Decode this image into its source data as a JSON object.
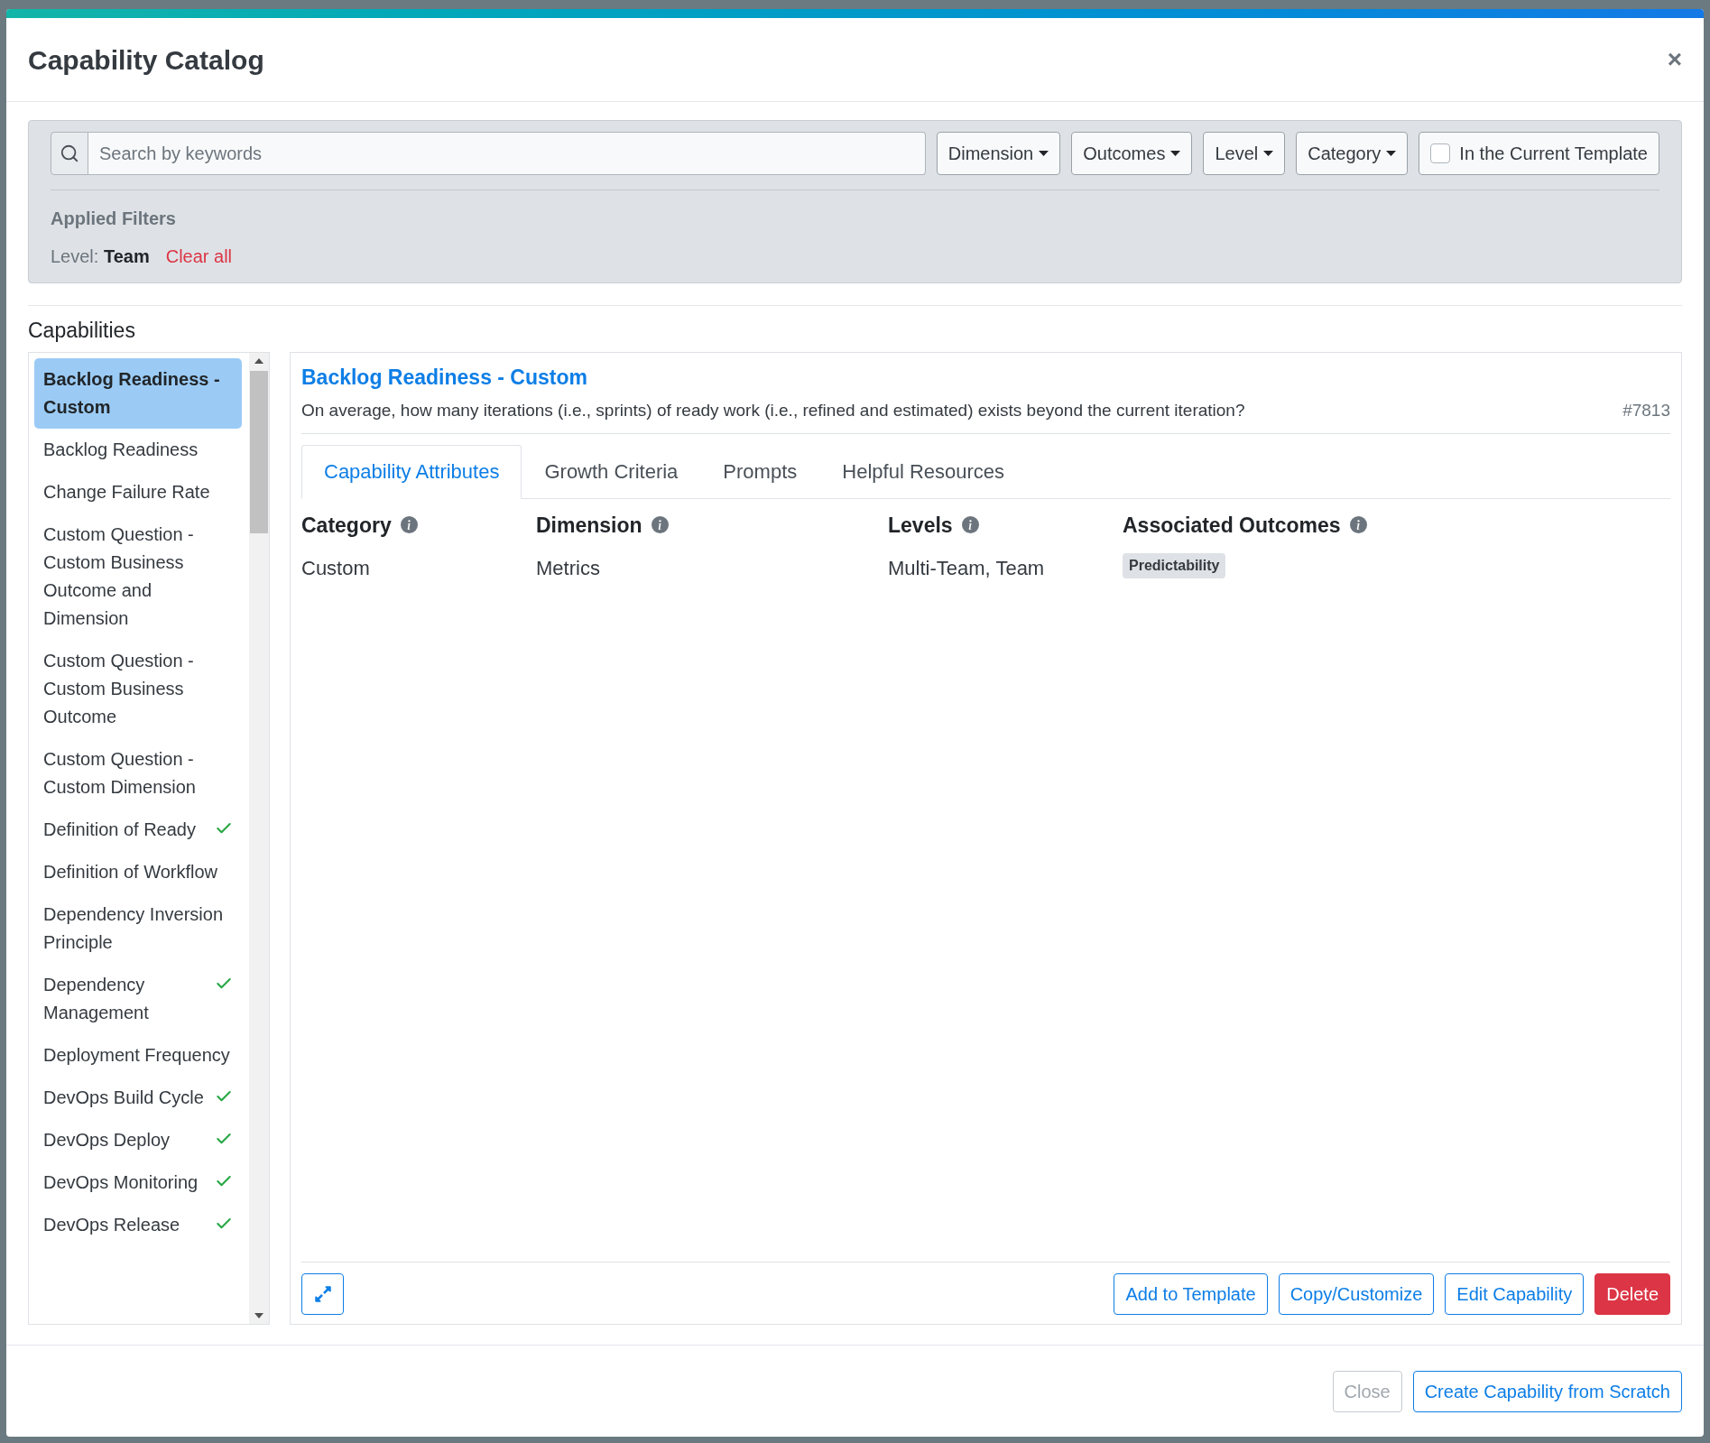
{
  "modal": {
    "title": "Capability Catalog",
    "close_symbol": "×"
  },
  "filters": {
    "search": {
      "placeholder": "Search by keywords"
    },
    "dropdowns": [
      "Dimension",
      "Outcomes",
      "Level",
      "Category"
    ],
    "template_toggle": {
      "label": "In the Current Template",
      "checked": false
    },
    "applied_title": "Applied Filters",
    "applied": [
      {
        "name": "Level:",
        "value": "Team"
      }
    ],
    "clear_all": "Clear all"
  },
  "capabilities_title": "Capabilities",
  "capabilities": [
    {
      "name": "Backlog Readiness - Custom",
      "selected": true,
      "in_template": false
    },
    {
      "name": "Backlog Readiness",
      "selected": false,
      "in_template": false
    },
    {
      "name": "Change Failure Rate",
      "selected": false,
      "in_template": false
    },
    {
      "name": "Custom Question - Custom Business Outcome and Dimension",
      "selected": false,
      "in_template": false
    },
    {
      "name": "Custom Question - Custom Business Outcome",
      "selected": false,
      "in_template": false
    },
    {
      "name": "Custom Question - Custom Dimension",
      "selected": false,
      "in_template": false
    },
    {
      "name": "Definition of Ready",
      "selected": false,
      "in_template": true
    },
    {
      "name": "Definition of Workflow",
      "selected": false,
      "in_template": false
    },
    {
      "name": "Dependency Inversion Principle",
      "selected": false,
      "in_template": false
    },
    {
      "name": "Dependency Management",
      "selected": false,
      "in_template": true
    },
    {
      "name": "Deployment Frequency",
      "selected": false,
      "in_template": false
    },
    {
      "name": "DevOps Build Cycle",
      "selected": false,
      "in_template": true
    },
    {
      "name": "DevOps Deploy",
      "selected": false,
      "in_template": true
    },
    {
      "name": "DevOps Monitoring",
      "selected": false,
      "in_template": true
    },
    {
      "name": "DevOps Release",
      "selected": false,
      "in_template": true
    }
  ],
  "detail": {
    "title": "Backlog Readiness - Custom",
    "question": "On average, how many iterations (i.e., sprints) of ready work (i.e., refined and estimated) exists beyond the current iteration?",
    "id": "#7813",
    "tabs": [
      {
        "label": "Capability Attributes",
        "selected": true
      },
      {
        "label": "Growth Criteria",
        "selected": false
      },
      {
        "label": "Prompts",
        "selected": false
      },
      {
        "label": "Helpful Resources",
        "selected": false
      }
    ],
    "attributes": [
      {
        "kind": "text",
        "label": "Category",
        "value": "Custom"
      },
      {
        "kind": "text",
        "label": "Dimension",
        "value": "Metrics"
      },
      {
        "kind": "text",
        "label": "Levels",
        "value": "Multi-Team, Team"
      },
      {
        "kind": "badges",
        "label": "Associated Outcomes",
        "values": [
          "Predictability"
        ]
      }
    ],
    "actions": [
      {
        "label": "Add to Template",
        "kind": "outline"
      },
      {
        "label": "Copy/Customize",
        "kind": "outline"
      },
      {
        "label": "Edit Capability",
        "kind": "outline"
      },
      {
        "label": "Delete",
        "kind": "danger"
      }
    ]
  },
  "footer": [
    {
      "label": "Close",
      "disabled": true
    },
    {
      "label": "Create Capability from Scratch",
      "disabled": false
    }
  ]
}
